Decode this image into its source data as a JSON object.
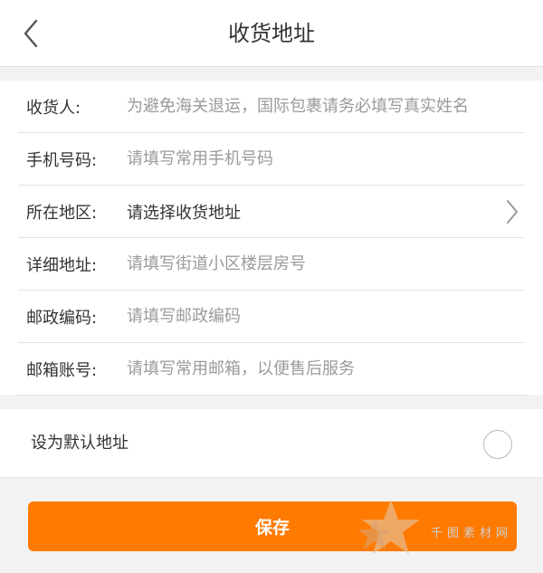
{
  "header": {
    "title": "收货地址"
  },
  "form": {
    "fields": [
      {
        "label": "收货人:",
        "placeholder": "为避免海关退运，国际包裹请务必填写真实姓名"
      },
      {
        "label": "手机号码:",
        "placeholder": "请填写常用手机号码"
      },
      {
        "label": "所在地区:",
        "value": "请选择收货地址"
      },
      {
        "label": "详细地址:",
        "placeholder": "请填写街道小区楼层房号"
      },
      {
        "label": "邮政编码:",
        "placeholder": "请填写邮政编码"
      },
      {
        "label": "邮箱账号:",
        "placeholder": "请填写常用邮箱，以便售后服务"
      }
    ]
  },
  "default_address": {
    "label": "设为默认地址",
    "checked": false
  },
  "save_button": {
    "label": "保存"
  },
  "watermark": {
    "text": "千图素材网"
  },
  "colors": {
    "accent": "#ff7a00",
    "background": "#f2f2f2",
    "placeholder": "#9a9a9a"
  },
  "icons": {
    "back": "chevron-left-icon",
    "region": "chevron-right-icon",
    "watermark": "star-icon"
  }
}
